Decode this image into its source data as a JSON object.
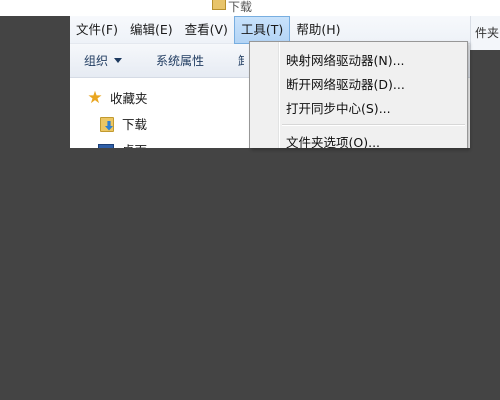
{
  "background_window": {
    "title_fragment": "下载",
    "right_fragment": "件夹"
  },
  "menubar": {
    "items": [
      {
        "label": "文件(F)"
      },
      {
        "label": "编辑(E)"
      },
      {
        "label": "查看(V)"
      },
      {
        "label": "工具(T)",
        "active": true
      },
      {
        "label": "帮助(H)"
      }
    ]
  },
  "toolbar": {
    "organize_label": "组织",
    "system_properties_label": "系统属性",
    "partial_label": "卸"
  },
  "nav": {
    "favorites_label": "收藏夹",
    "downloads_label": "下载",
    "desktop_label": "桌面"
  },
  "tools_menu": {
    "items": [
      {
        "label": "映射网络驱动器(N)..."
      },
      {
        "label": "断开网络驱动器(D)..."
      },
      {
        "label": "打开同步中心(S)..."
      },
      {
        "label": "文件夹选项(O)..."
      }
    ]
  },
  "colors": {
    "backdrop": "#444444",
    "menu_highlight": "#b3d4f5",
    "menu_bg": "#f0f0f0",
    "toolbar_text": "#1e3a5f"
  },
  "icons": [
    "star-icon",
    "download-folder-icon",
    "desktop-icon",
    "chevron-down-icon"
  ]
}
